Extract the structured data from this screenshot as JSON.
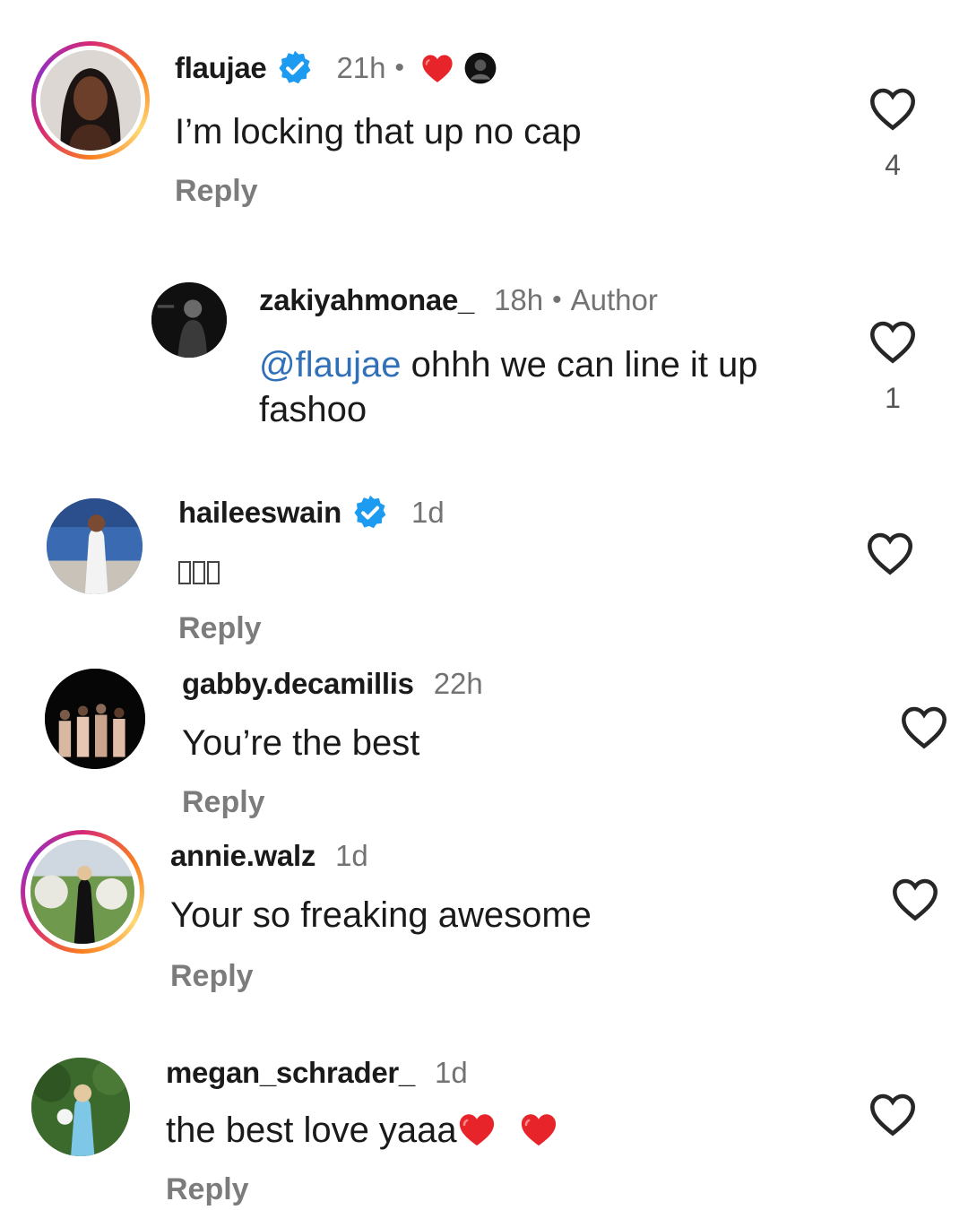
{
  "comments": [
    {
      "username": "flaujae",
      "verified": true,
      "time": "21h",
      "text": "I’m locking that up no cap",
      "reply_label": "Reply",
      "like_count": "4",
      "reactions": [
        "red-heart",
        "creator-avatar"
      ]
    },
    {
      "username": "zakiyahmonae_",
      "verified": false,
      "time": "18h",
      "author_badge": "Author",
      "mention": "@flaujae",
      "text_line1": " ohhh we can line it up",
      "text_line2": "fashoo",
      "like_count": "1"
    },
    {
      "username": "haileeswain",
      "verified": true,
      "time": "1d",
      "text_missing_glyphs": 3,
      "reply_label": "Reply"
    },
    {
      "username": "gabby.decamillis",
      "verified": false,
      "time": "22h",
      "text": "You’re the best",
      "reply_label": "Reply"
    },
    {
      "username": "annie.walz",
      "verified": false,
      "time": "1d",
      "text": "Your so freaking awesome",
      "reply_label": "Reply"
    },
    {
      "username": "megan_schrader_",
      "verified": false,
      "time": "1d",
      "text": "the best love yaaa",
      "reply_label": "Reply",
      "trailing_emoji": [
        "red-heart",
        "red-heart"
      ]
    }
  ],
  "colors": {
    "mention": "#2f70b8",
    "verified": "#1d9bf0",
    "heart_red": "#e8242b",
    "secondary_text": "#737373"
  }
}
